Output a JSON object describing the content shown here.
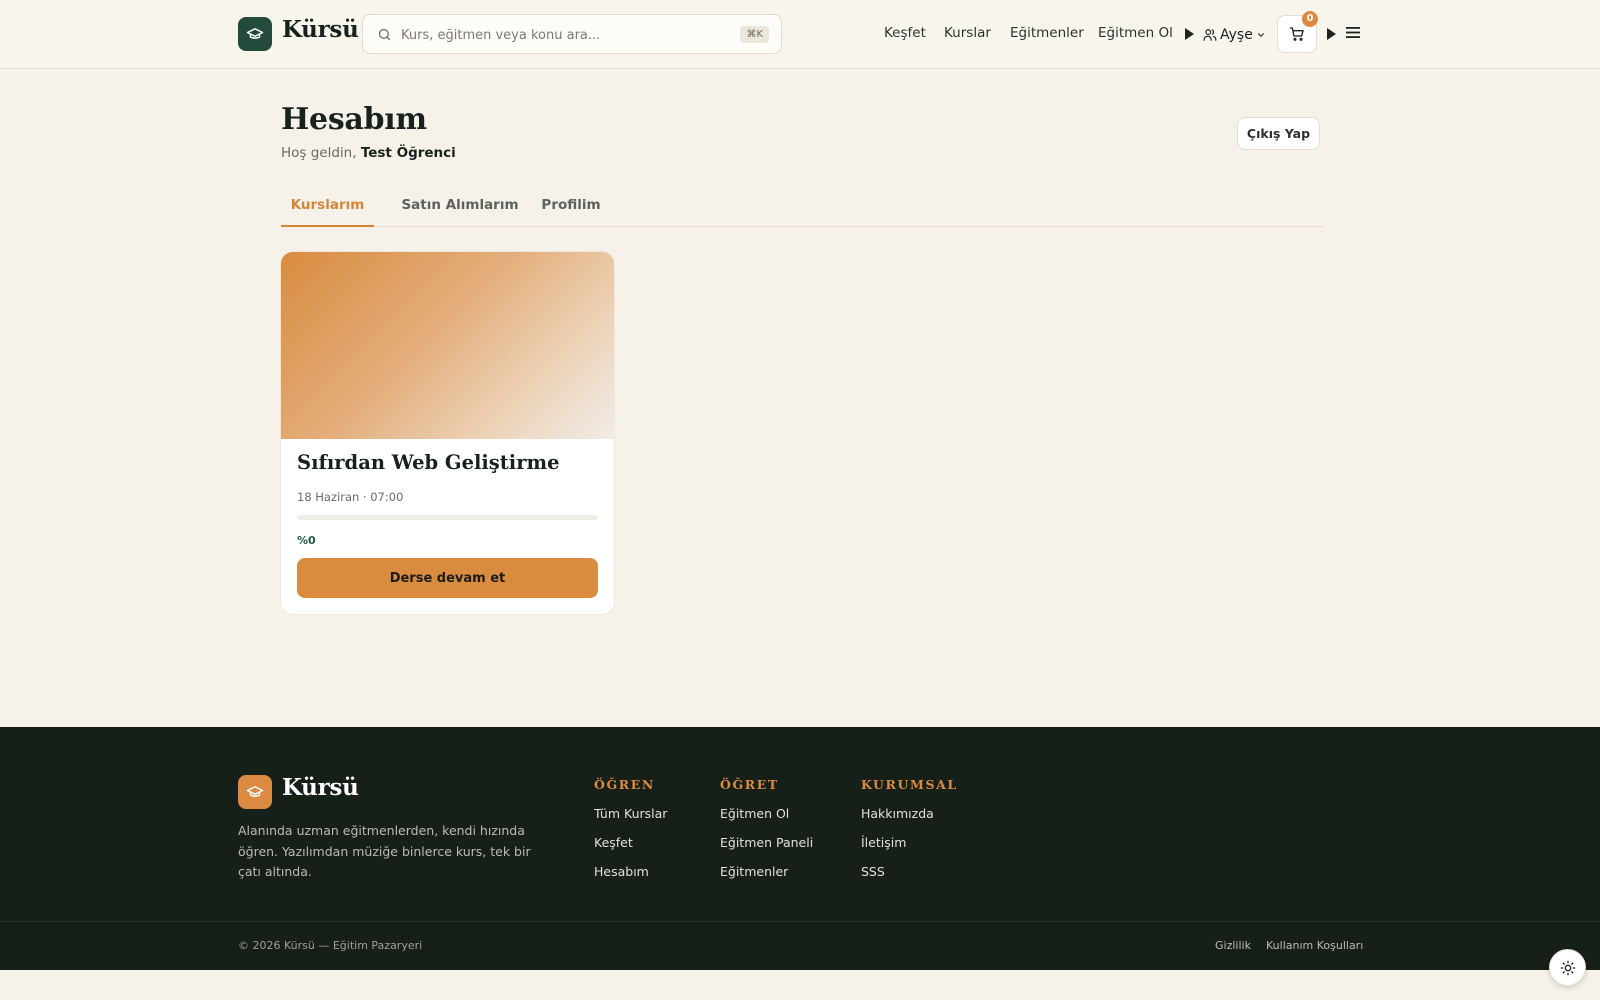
{
  "brand": {
    "name": "Kürsü",
    "color": "#234a3b",
    "accent": "#db8b41"
  },
  "search": {
    "placeholder": "Kurs, eğitmen veya konu ara...",
    "shortcut": "⌘K"
  },
  "nav": {
    "items": [
      "Keşfet",
      "Kurslar",
      "Eğitmenler",
      "Eğitmen Ol"
    ],
    "user_name": "Ayşe",
    "cart_count": "0"
  },
  "account": {
    "title": "Hesabım",
    "welcome_prefix": "Hoş geldin,",
    "user_full_name": "Test Öğrenci",
    "logout_label": "Çıkış Yap"
  },
  "tabs": [
    {
      "label": "Kurslarım",
      "active": true
    },
    {
      "label": "Satın Alımlarım",
      "active": false
    },
    {
      "label": "Profilim",
      "active": false
    }
  ],
  "courses": [
    {
      "title": "Sıfırdan Web Geliştirme",
      "date": "18 Haziran · 07:00",
      "progress": 0,
      "progress_label": "%0",
      "cta": "Derse devam et"
    }
  ],
  "footer": {
    "brand": "Kürsü",
    "description": "Alanında uzman eğitmenlerden, kendi hızında öğren. Yazılımdan müziğe binlerce kurs, tek bir çatı altında.",
    "columns": [
      {
        "heading": "ÖĞREN",
        "links": [
          "Tüm Kurslar",
          "Keşfet",
          "Hesabım"
        ]
      },
      {
        "heading": "ÖĞRET",
        "links": [
          "Eğitmen Ol",
          "Eğitmen Paneli",
          "Eğitmenler"
        ]
      },
      {
        "heading": "KURUMSAL",
        "links": [
          "Hakkımızda",
          "İletişim",
          "SSS"
        ]
      }
    ],
    "copyright": "© 2026 Kürsü — Eğitim Pazaryeri",
    "legal": [
      "Gizlilik",
      "Kullanım Koşulları"
    ]
  }
}
